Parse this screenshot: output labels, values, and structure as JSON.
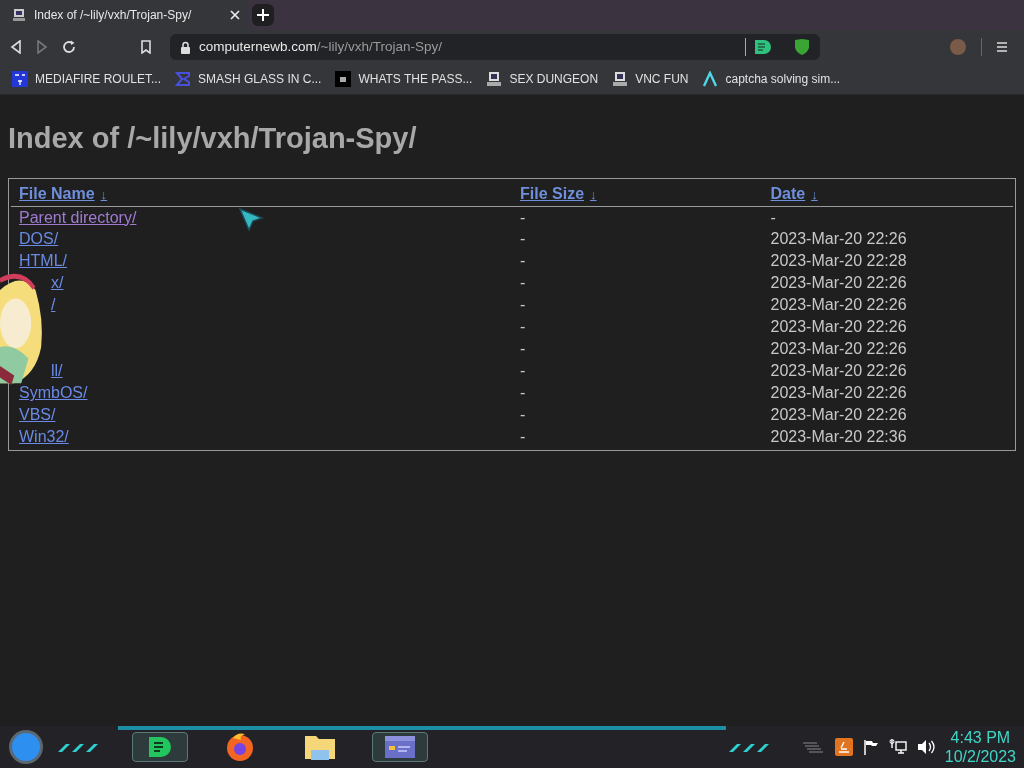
{
  "tab": {
    "title": "Index of /~lily/vxh/Trojan-Spy/",
    "selected": true
  },
  "address": {
    "host": "computernewb.com",
    "path": "/~lily/vxh/Trojan-Spy/"
  },
  "bookmarks": [
    {
      "label": "MEDIAFIRE ROULET...",
      "kind": "mf"
    },
    {
      "label": "SMASH GLASS IN C...",
      "kind": "sigma"
    },
    {
      "label": "WHATS THE PASS...",
      "kind": "dark"
    },
    {
      "label": "SEX DUNGEON",
      "kind": "pc"
    },
    {
      "label": "VNC FUN",
      "kind": "pc"
    },
    {
      "label": "captcha solving sim...",
      "kind": "lambda"
    }
  ],
  "heading": "Index of /~lily/vxh/Trojan-Spy/",
  "table": {
    "columns": [
      {
        "label": "File Name",
        "sort": "↓"
      },
      {
        "label": "File Size",
        "sort": "↓"
      },
      {
        "label": "Date",
        "sort": "↓"
      }
    ],
    "rows": [
      {
        "name": "Parent directory/",
        "visited": true,
        "clipped": false,
        "size": "-",
        "date": "-"
      },
      {
        "name": "DOS/",
        "visited": false,
        "clipped": false,
        "size": "-",
        "date": "2023-Mar-20 22:26"
      },
      {
        "name": "HTML/",
        "visited": false,
        "clipped": false,
        "size": "-",
        "date": "2023-Mar-20 22:28"
      },
      {
        "name": "x/",
        "visited": false,
        "clipped": true,
        "size": "-",
        "date": "2023-Mar-20 22:26"
      },
      {
        "name": "/",
        "visited": false,
        "clipped": true,
        "size": "-",
        "date": "2023-Mar-20 22:26"
      },
      {
        "size": "-",
        "date": "2023-Mar-20 22:26"
      },
      {
        "size": "-",
        "date": "2023-Mar-20 22:26"
      },
      {
        "name": "ll/",
        "visited": false,
        "clipped": true,
        "size": "-",
        "date": "2023-Mar-20 22:26"
      },
      {
        "name": "SymbOS/",
        "visited": false,
        "clipped": false,
        "size": "-",
        "date": "2023-Mar-20 22:26"
      },
      {
        "name": "VBS/",
        "visited": false,
        "clipped": false,
        "size": "-",
        "date": "2023-Mar-20 22:26"
      },
      {
        "name": "Win32/",
        "visited": false,
        "clipped": false,
        "size": "-",
        "date": "2023-Mar-20 22:36"
      }
    ]
  },
  "taskbar": {
    "apps": [
      {
        "kind": "chat",
        "selected": true
      },
      {
        "kind": "browser",
        "selected": false
      },
      {
        "kind": "folder",
        "selected": false
      },
      {
        "kind": "window",
        "selected": true
      }
    ],
    "clock": {
      "time": "4:43 PM",
      "date": "10/2/2023"
    }
  }
}
